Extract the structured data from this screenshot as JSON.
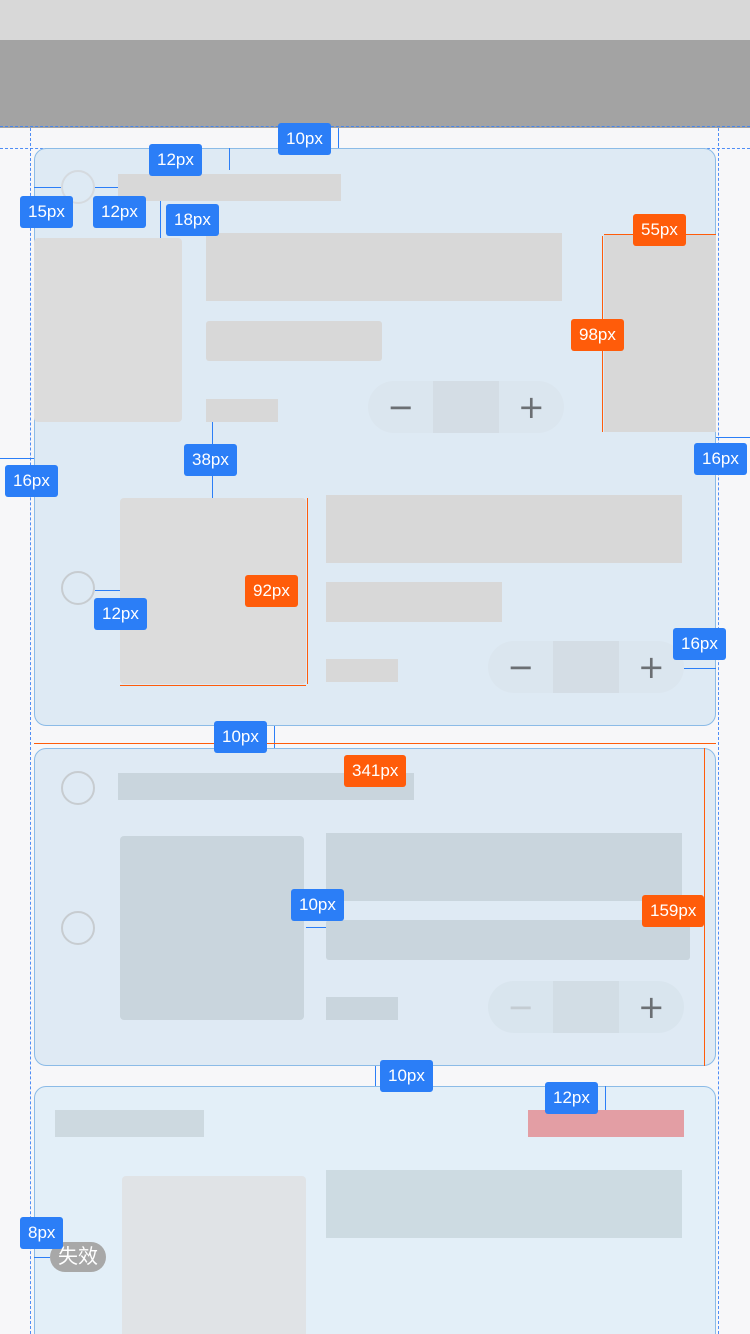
{
  "measurements": {
    "m1": "10px",
    "m2": "12px",
    "m3": "15px",
    "m4": "12px",
    "m5": "18px",
    "m6": "55px",
    "m7": "98px",
    "m8": "38px",
    "m9": "16px",
    "m10": "16px",
    "m11": "92px",
    "m12": "12px",
    "m13": "16px",
    "m14": "10px",
    "m15": "341px",
    "m16": "10px",
    "m17": "159px",
    "m18": "10px",
    "m19": "12px",
    "m20": "8px"
  },
  "stepper": {
    "minus": "−",
    "plus": "+"
  },
  "invalid_badge": "失效",
  "colors": {
    "blue_tag": "#2b7ef7",
    "orange_tag": "#ff5c0a",
    "card_bg": "#deeaf4",
    "pink_bar": "#e39ea4"
  }
}
